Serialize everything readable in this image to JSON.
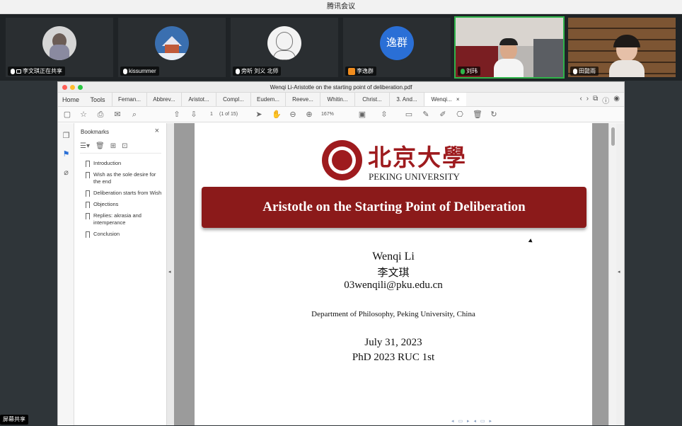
{
  "meeting": {
    "title": "腾讯会议"
  },
  "participants": [
    {
      "name": "李文琪正在共享",
      "sharing": true
    },
    {
      "name": "kissummer"
    },
    {
      "name": "旁听 刘义 北师"
    },
    {
      "name": "李逸群",
      "avatar_text": "逸群"
    },
    {
      "name": "刘玮",
      "active": true
    },
    {
      "name": "田懿雨"
    }
  ],
  "pdf_window": {
    "title": "Wenqi Li-Aristotle on the starting point of deliberation.pdf",
    "home_tab": "Home",
    "tools_tab": "Tools",
    "doc_tabs": [
      "Fernan...",
      "Abbrev...",
      "Aristot...",
      "Compl...",
      "Eudem...",
      "Reeve...",
      "Whitin...",
      "Christ...",
      "3. And...",
      "Wenqi..."
    ],
    "current_tab_close": "×",
    "page_number": "1",
    "page_of": "(1 of 15)",
    "zoom": "167%"
  },
  "bookmarks": {
    "heading": "Bookmarks",
    "close": "×",
    "items": [
      "Introduction",
      "Wish as the sole desire for the end",
      "Deliberation starts from Wish",
      "Objections",
      "Replies: akrasia and intemperance",
      "Conclusion"
    ]
  },
  "document": {
    "university_cn": "北京大學",
    "university_en": "PEKING UNIVERSITY",
    "title": "Aristotle on the Starting Point of Deliberation",
    "author": "Wenqi Li",
    "author_cn": "李文琪",
    "email": "03wenqili@pku.edu.cn",
    "department": "Department of Philosophy, Peking University, China",
    "date": "July 31, 2023",
    "program": "PhD 2023 RUC 1st"
  },
  "share_badge": "屏幕共享",
  "colors": {
    "pku_red": "#9e1b1e",
    "banner_red": "#8b1a1a",
    "active_speaker": "#2fb34a"
  }
}
